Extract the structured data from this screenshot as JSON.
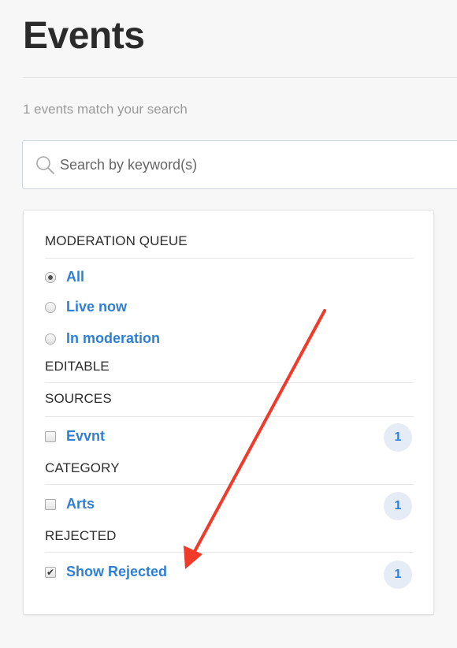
{
  "page": {
    "title": "Events",
    "match_count_text": "1 events match your search"
  },
  "search": {
    "placeholder": "Search by keyword(s)",
    "value": "",
    "icon": "search-icon"
  },
  "filters": {
    "moderation_queue": {
      "heading": "MODERATION QUEUE",
      "options": [
        {
          "label": "All",
          "checked": true
        },
        {
          "label": "Live now",
          "checked": false
        },
        {
          "label": "In moderation",
          "checked": false
        }
      ]
    },
    "editable": {
      "heading": "EDITABLE"
    },
    "sources": {
      "heading": "SOURCES",
      "items": [
        {
          "label": "Evvnt",
          "count": "1",
          "checked": false
        }
      ]
    },
    "category": {
      "heading": "CATEGORY",
      "items": [
        {
          "label": "Arts",
          "count": "1",
          "checked": false
        }
      ]
    },
    "rejected": {
      "heading": "REJECTED",
      "items": [
        {
          "label": "Show Rejected",
          "count": "1",
          "checked": true
        }
      ]
    }
  },
  "colors": {
    "link": "#2f7fd6",
    "badge_bg": "#e6ecf5",
    "annotation_arrow": "#f03a2a"
  }
}
